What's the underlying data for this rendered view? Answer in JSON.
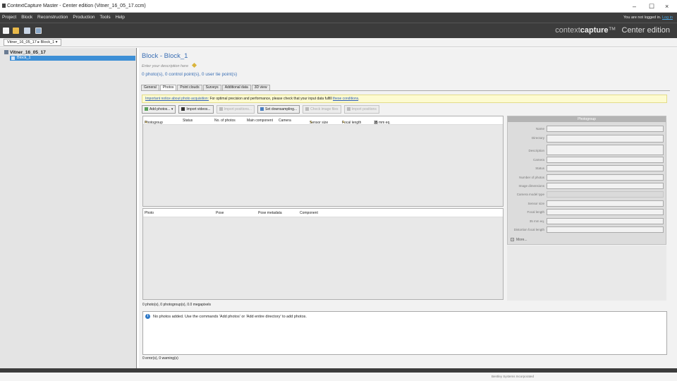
{
  "window": {
    "title": "ContextCapture Master - Center edition (Vitner_16_05_17.ccm)",
    "minimize_glyph": "–",
    "maximize_glyph": "☐",
    "close_glyph": "×"
  },
  "menu": {
    "items": [
      "Project",
      "Block",
      "Reconstruction",
      "Production",
      "Tools",
      "Help"
    ],
    "login_text": "You are not logged in.",
    "login_link": "Log in"
  },
  "toolbar": {
    "icons": [
      "new-project-icon",
      "open-project-icon",
      "save-project-icon",
      "settings-icon"
    ]
  },
  "brand": {
    "prefix": "context",
    "bold": "capture",
    "tm": "™",
    "edition": "Center edition"
  },
  "breadcrumb": {
    "project": "Vitner_16_05_17",
    "sep": "▸",
    "block": "Block_1",
    "arrow": "▾"
  },
  "tree": {
    "root": "Vitner_16_05_17",
    "child": "Block_1"
  },
  "block": {
    "title": "Block - Block_1",
    "description": "Enter your description here",
    "counts": "0 photo(s), 0 control point(s), 0 user tie point(s)"
  },
  "tabs": [
    {
      "label": "General"
    },
    {
      "label": "Photos"
    },
    {
      "label": "Point clouds"
    },
    {
      "label": "Surveys"
    },
    {
      "label": "Additional data"
    },
    {
      "label": "3D view"
    }
  ],
  "warning": {
    "prefix": "Important notice about photo acquisition:",
    "middle": " For optimal precision and performance, please check that your input data fulfill ",
    "link": "these conditions",
    "suffix": "."
  },
  "buttons": {
    "add_photos": "Add photos...",
    "import_videos": "Import videos...",
    "import_positions": "Import positions...",
    "set_downsampling": "Set downsampling...",
    "check_image_files": "Check image files",
    "import_positions2": "Import positions"
  },
  "groups_table": {
    "columns": [
      "Photogroup",
      "Status",
      "No. of photos",
      "Main component",
      "Camera",
      "Sensor size",
      "Focal length",
      "35 mm eq."
    ]
  },
  "photos_table": {
    "columns": [
      "Photo",
      "Pose",
      "Pose metadata",
      "Component"
    ]
  },
  "photogroup_panel": {
    "title": "Photogroup",
    "fields": [
      {
        "label": "Name"
      },
      {
        "label": "Directory"
      },
      {
        "label": "Description"
      },
      {
        "label": "Camera"
      },
      {
        "label": "Status"
      },
      {
        "label": "Number of photos"
      },
      {
        "label": "Image dimensions"
      },
      {
        "label": "Camera model type"
      },
      {
        "label": "Sensor size"
      },
      {
        "label": "Focal length"
      },
      {
        "label": "35 mm eq."
      },
      {
        "label": "Distortion focal length"
      }
    ],
    "more": "More..."
  },
  "summary": "0 photo(s), 0 photogroup(s), 0.0 megapixels",
  "message": "No photos added. Use the commands 'Add photos' or 'Add entire directory' to add photos.",
  "errors": "0 error(s), 0 warning(s)",
  "taskbar": {
    "text": "Bentley Systems Incorporated"
  },
  "colors": {
    "dark_chrome": "#3c3c3c",
    "accent_blue": "#3d8fd6",
    "title_blue": "#3b6fb4",
    "warning_bg": "#fdfbd0"
  }
}
